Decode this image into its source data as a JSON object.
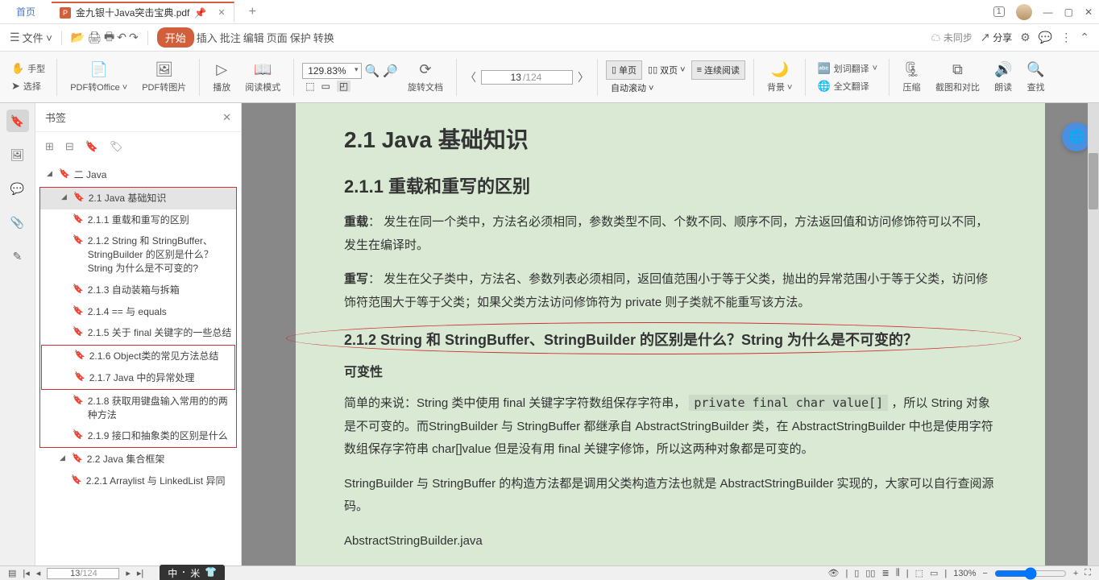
{
  "titlebar": {
    "home": "首页",
    "doc_name": "金九银十Java突击宝典.pdf",
    "pin": "📌",
    "close": "✕",
    "add": "+",
    "badge": "1"
  },
  "menubar": {
    "file_label": "文件",
    "items": [
      "开始",
      "插入",
      "批注",
      "编辑",
      "页面",
      "保护",
      "转换"
    ],
    "sync": "未同步",
    "share": "分享"
  },
  "tools": {
    "hand": "手型",
    "select": "选择",
    "pdf2office": "PDF转Office",
    "pdf2img": "PDF转图片",
    "play": "播放",
    "read": "阅读模式",
    "zoom": "129.83%",
    "rotate": "旋转文档",
    "page_cur": "13",
    "page_total": "/124",
    "single": "单页",
    "double": "双页",
    "cont": "连续阅读",
    "autoscroll": "自动滚动",
    "bg": "背景",
    "wordtrans": "划词翻译",
    "fulltrans": "全文翻译",
    "compress": "压缩",
    "compare": "截图和对比",
    "read2": "朗读",
    "find": "查找"
  },
  "bookmarks": {
    "title": "书签",
    "root": "二 Java",
    "s21": "2.1 Java 基础知识",
    "items": [
      "2.1.1 重载和重写的区别",
      "2.1.2 String 和 StringBuffer、StringBuilder 的区别是什么？String 为什么是不可变的?",
      "2.1.3 自动装箱与拆箱",
      "2.1.4 == 与  equals",
      "2.1.5 关于 final 关键字的一些总结",
      "2.1.6 Object类的常见方法总结",
      "2.1.7 Java 中的异常处理",
      "2.1.8 获取用键盘输入常用的的两种方法",
      "2.1.9 接口和抽象类的区别是什么"
    ],
    "s22": "2.2 Java 集合框架",
    "s22_1": "2.2.1 Arraylist 与 LinkedList 异同"
  },
  "doc": {
    "h1": "2.1 Java 基础知识",
    "h2_1": "2.1.1 重载和重写的区别",
    "p_overload_lbl": "重载",
    "p_overload": "：  发生在同一个类中，方法名必须相同，参数类型不同、个数不同、顺序不同，方法返回值和访问修饰符可以不同，发生在编译时。",
    "p_override_lbl": "重写",
    "p_override": "：  发生在父子类中，方法名、参数列表必须相同，返回值范围小于等于父类，抛出的异常范围小于等于父类，访问修饰符范围大于等于父类；如果父类方法访问修饰符为 private 则子类就不能重写该方法。",
    "h2_2": "2.1.2 String 和 StringBuffer、StringBuilder 的区别是什么？String 为什么是不可变的？",
    "h4": "可变性",
    "p3a": "简单的来说：String 类中使用 final 关键字字符数组保存字符串， ",
    "p3code": "private  final  char  value[]",
    "p3b": " ，所以 String 对象是不可变的。而StringBuilder 与 StringBuffer 都继承自 AbstractStringBuilder 类，在 AbstractStringBuilder 中也是使用字符数组保存字符串 char[]value 但是没有用 final 关键字修饰，所以这两种对象都是可变的。",
    "p4": "StringBuilder 与 StringBuffer 的构造方法都是调用父类构造方法也就是 AbstractStringBuilder 实现的，大家可以自行查阅源码。",
    "p5": "AbstractStringBuilder.java"
  },
  "status": {
    "page_cur": "13",
    "page_total": "/124",
    "zoom": "130%",
    "dark1": "中",
    "dark2": "米"
  }
}
